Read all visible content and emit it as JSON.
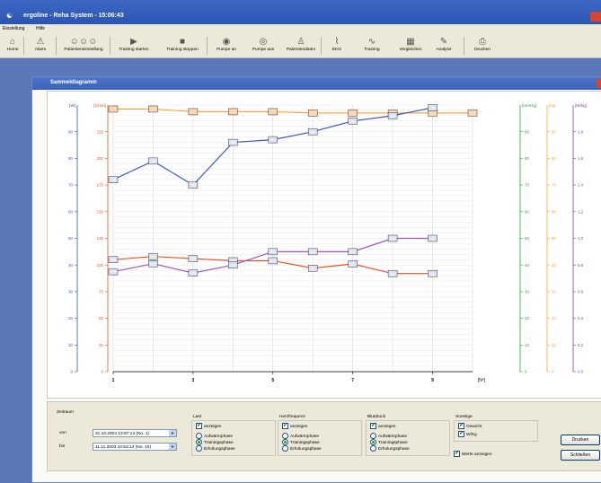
{
  "window": {
    "title": "ergoline - Reha System - 15:06:43"
  },
  "menu": [
    "Einstellung",
    "Hilfe"
  ],
  "toolbar": [
    {
      "label": "Home",
      "icon": "home-icon",
      "glyph": "⌂"
    },
    {
      "label": "Alarm",
      "icon": "alarm-icon",
      "glyph": "⚠"
    },
    {
      "label": "Patienteneinstellung",
      "icon": "patients-icon",
      "glyph": "☺☺☺"
    },
    {
      "label": "Training starten",
      "icon": "play-icon",
      "glyph": "▶"
    },
    {
      "label": "Training stoppen",
      "icon": "stop-icon",
      "glyph": "■"
    },
    {
      "label": "Pumpe an",
      "icon": "pump-on-icon",
      "glyph": "◉"
    },
    {
      "label": "Pumpe aus",
      "icon": "pump-off-icon",
      "glyph": "◎"
    },
    {
      "label": "Patientendaten",
      "icon": "patient-data-icon",
      "glyph": "♙"
    },
    {
      "label": "EKG",
      "icon": "ekg-icon",
      "glyph": "⌇"
    },
    {
      "label": "Training",
      "icon": "training-icon",
      "glyph": "∿"
    },
    {
      "label": "Vergleichen",
      "icon": "compare-icon",
      "glyph": "▦"
    },
    {
      "label": "Analyse",
      "icon": "analysis-icon",
      "glyph": "✎"
    },
    {
      "label": "Drucken",
      "icon": "printer-icon",
      "glyph": "⎙"
    }
  ],
  "dialog": {
    "title": "Sammeldiagramm"
  },
  "chart_data": {
    "type": "line",
    "x": [
      1,
      2,
      3,
      4,
      5,
      6,
      7,
      8,
      9,
      10
    ],
    "xticks": [
      "1",
      "3",
      "5",
      "7",
      "9"
    ],
    "xunit": "[Nº]",
    "axes": [
      {
        "label": "[W]",
        "color": "#3a57c0",
        "ticks": [
          "0",
          "10",
          "20",
          "30",
          "40",
          "50",
          "60",
          "70",
          "80",
          "90"
        ]
      },
      {
        "label": "[1/min]",
        "color": "#f05020",
        "ticks": [
          "0",
          "25",
          "50",
          "75",
          "100",
          "125",
          "150",
          "175",
          "200",
          "225"
        ]
      },
      {
        "label": "[mmHg]",
        "color": "#36a036",
        "ticks": [
          "0",
          "10",
          "20",
          "30",
          "40",
          "50",
          "60",
          "70",
          "80",
          "90"
        ]
      },
      {
        "label": "[kg]",
        "color": "#ffa040",
        "ticks": [
          "0",
          "10",
          "20",
          "30",
          "40",
          "50",
          "60",
          "70",
          "80",
          "90"
        ]
      },
      {
        "label": "[W/kg]",
        "color": "#7a3fa8",
        "ticks": [
          "0.0",
          "0.2",
          "0.4",
          "0.6",
          "0.8",
          "1.0",
          "1.2",
          "1.4",
          "1.6",
          "1.8"
        ]
      }
    ],
    "series": [
      {
        "color": "#ffa040",
        "values": [
          98.5,
          98.5,
          97.5,
          97.5,
          97.5,
          97,
          97,
          97,
          97,
          97
        ],
        "labels": [
          "",
          "",
          "",
          "",
          "",
          "",
          "",
          "",
          "",
          ""
        ]
      },
      {
        "color": "#3a57c0",
        "values": [
          72,
          79,
          70,
          86,
          87,
          90,
          94,
          96,
          99
        ],
        "labels": [
          "72",
          "79",
          "70",
          "86",
          "87",
          "90",
          "94",
          "96",
          "99"
        ]
      },
      {
        "color": "#f05020",
        "values": [
          105,
          108,
          106,
          104,
          104,
          97,
          101,
          92,
          92
        ],
        "labels": [
          "105",
          "108",
          "106",
          "104",
          "104",
          "97",
          "101",
          "92",
          "92"
        ]
      },
      {
        "color": "#a050c8",
        "values": [
          0.75,
          0.81,
          0.74,
          0.8,
          0.9,
          0.9,
          0.9,
          1.0,
          1.0
        ],
        "labels": [
          "0.75",
          "0.81",
          "0.74",
          "0.8",
          "0.9",
          "0.9",
          "0.9",
          "1.0",
          "1.0"
        ]
      }
    ]
  },
  "controls": {
    "zeitraum": {
      "title": "Zeitraum",
      "von_label": "von",
      "von_value": "31.10.2003 13:57:13 (No. 1)",
      "bis_label": "bis",
      "bis_value": "11.11.2003 10:53:13 (No. 10)"
    },
    "last": {
      "title": "Last",
      "show": "anzeigen",
      "options": [
        "Aufwärmphase",
        "Trainingsphase",
        "Erholungsphase"
      ]
    },
    "herz": {
      "title": "Herzfrequenz",
      "show": "anzeigen",
      "options": [
        "Aufwärmphase",
        "Trainingsphase",
        "Erholungsphase"
      ]
    },
    "blut": {
      "title": "Blutdruck",
      "show": "anzeigen",
      "options": [
        "Aufwärmphase",
        "Trainingsphase",
        "Erholungsphase"
      ]
    },
    "sonstige": {
      "title": "Sonstige",
      "items": [
        "Gewicht",
        "W/Kg"
      ]
    },
    "werte": "Werte anzeigen",
    "drucken": "Drucken",
    "schliessen": "Schließen"
  }
}
